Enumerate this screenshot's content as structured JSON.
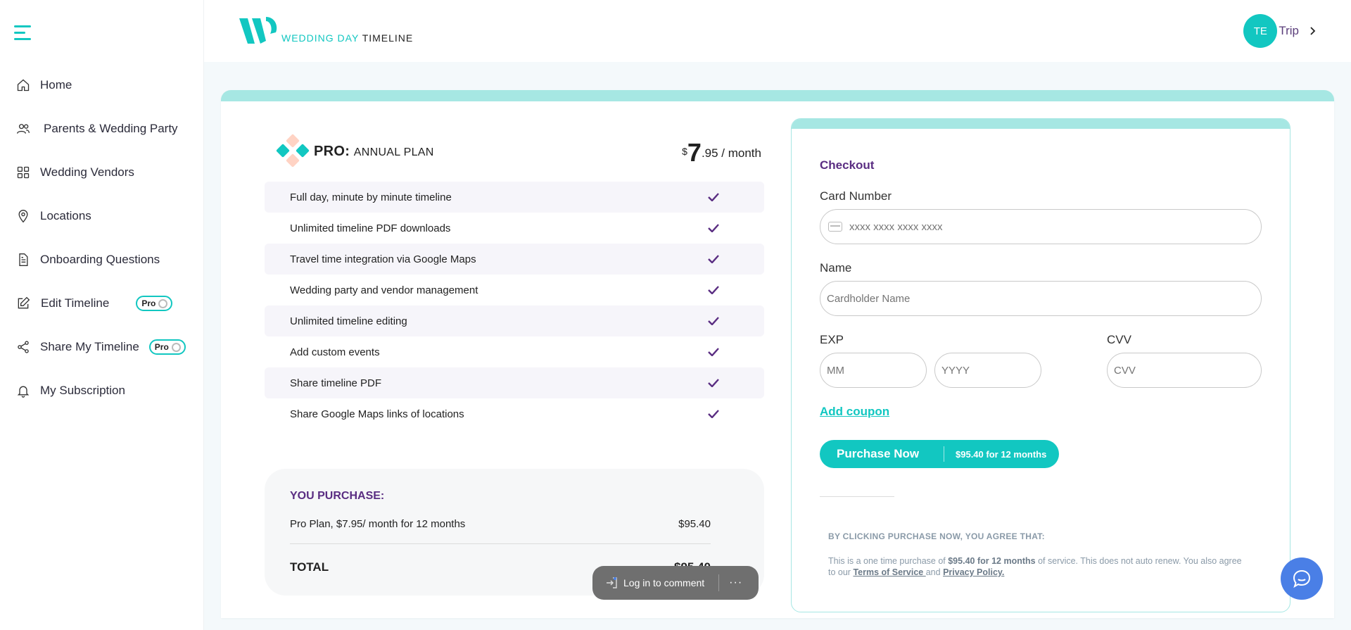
{
  "sidebar": {
    "items": [
      {
        "label": "Home",
        "icon": "home-icon"
      },
      {
        "label": "Parents & Wedding Party",
        "icon": "users-icon"
      },
      {
        "label": "Wedding Vendors",
        "icon": "grid-icon"
      },
      {
        "label": "Locations",
        "icon": "map-pin-icon"
      },
      {
        "label": "Onboarding Questions",
        "icon": "document-icon"
      },
      {
        "label": "Edit Timeline",
        "icon": "edit-icon",
        "badge": "Pro"
      },
      {
        "label": "Share My Timeline",
        "icon": "share-icon",
        "badge": "Pro"
      },
      {
        "label": "My Subscription",
        "icon": "bell-icon"
      }
    ]
  },
  "header": {
    "logo_text_accent": "WEDDING DAY",
    "logo_text": "TIMELINE",
    "user_initials": "TE",
    "user_name": "Trip"
  },
  "plan": {
    "title_bold": "PRO:",
    "title_rest": "ANNUAL PLAN",
    "price_currency": "$",
    "price_whole": "7",
    "price_rest": ".95 / month",
    "features": [
      "Full day, minute by minute timeline",
      "Unlimited timeline PDF downloads",
      "Travel time integration via Google Maps",
      "Wedding party and vendor management",
      "Unlimited timeline editing",
      "Add custom events",
      "Share timeline PDF",
      "Share Google Maps links of locations"
    ]
  },
  "purchase": {
    "title": "YOU PURCHASE:",
    "item_label": "Pro Plan, $7.95/ month for 12 months",
    "item_price": "$95.40",
    "total_label": "TOTAL",
    "total_value": "$95.40"
  },
  "checkout": {
    "title": "Checkout",
    "card_label": "Card Number",
    "card_placeholder": "xxxx xxxx xxxx xxxx",
    "name_label": "Name",
    "name_placeholder": "Cardholder Name",
    "exp_label": "EXP",
    "mm_placeholder": "MM",
    "yyyy_placeholder": "YYYY",
    "cvv_label": "CVV",
    "cvv_placeholder": "CVV",
    "coupon": "Add coupon",
    "button_main": "Purchase Now",
    "button_sub": "$95.40 for 12 months",
    "agree": "BY CLICKING PURCHASE NOW, YOU AGREE THAT:",
    "terms_1": "This is a one time purchase of ",
    "terms_bold": "$95.40 for 12 months",
    "terms_2": " of service. This does not auto renew. You also agree to our ",
    "terms_link1": "Terms of Service ",
    "terms_and": "and ",
    "terms_link2": "Privacy Policy."
  },
  "comment": {
    "label": "Log in to comment",
    "more": "···"
  },
  "colors": {
    "accent": "#12c7c1",
    "purple": "#5a2d82",
    "chat": "#4a7fe6"
  }
}
